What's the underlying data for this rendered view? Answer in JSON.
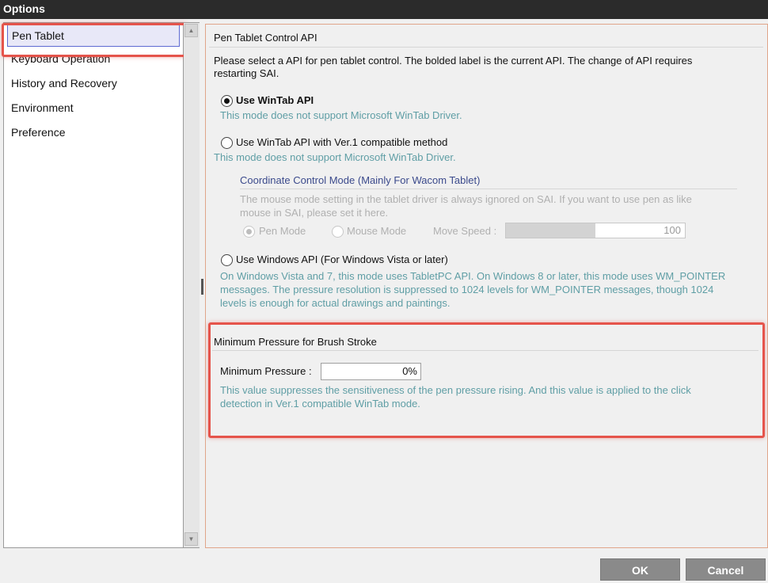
{
  "window": {
    "title": "Options"
  },
  "sidebar": {
    "items": [
      {
        "label": "Pen Tablet"
      },
      {
        "label": "Keyboard Operation"
      },
      {
        "label": "History and Recovery"
      },
      {
        "label": "Environment"
      },
      {
        "label": "Preference"
      }
    ]
  },
  "api_section": {
    "title": "Pen Tablet Control API",
    "intro_line1": "Please select a API for pen tablet control. The bolded label is the current API. The change of API requires",
    "intro_line2": "restarting SAI.",
    "options": [
      {
        "label": "Use WinTab API",
        "desc": "This mode does not support Microsoft WinTab Driver.",
        "selected": true
      },
      {
        "label": "Use WinTab API with Ver.1 compatible method",
        "desc": "This mode does not support Microsoft WinTab Driver.",
        "selected": false
      },
      {
        "label": "Use Windows API (For Windows Vista or later)",
        "desc_line1": "On Windows Vista and 7, this mode uses TabletPC API. On Windows 8 or later, this mode uses WM_POINTER",
        "desc_line2": "messages. The pressure resolution is suppressed to 1024 levels for WM_POINTER messages, though 1024",
        "desc_line3": "levels is enough for actual drawings and paintings.",
        "selected": false
      }
    ],
    "coordinate": {
      "title": "Coordinate Control Mode (Mainly For Wacom Tablet)",
      "desc_line1": "The mouse mode setting in the tablet driver is always ignored on SAI. If you want to use pen as like",
      "desc_line2": "mouse in SAI, please set it here.",
      "pen_mode": "Pen Mode",
      "mouse_mode": "Mouse Mode",
      "move_speed_label": "Move Speed :",
      "move_speed_value": "100",
      "move_speed_fraction": 0.5
    }
  },
  "pressure_section": {
    "title": "Minimum Pressure for Brush Stroke",
    "label": "Minimum Pressure :",
    "value": "0%",
    "desc_line1": "This value suppresses the sensitiveness of the pen pressure rising. And this value is applied to the click",
    "desc_line2": "detection in Ver.1 compatible WinTab mode."
  },
  "buttons": {
    "ok": "OK",
    "cancel": "Cancel"
  },
  "colors": {
    "highlight": "#e5544b",
    "section_title": "#8b3a14",
    "description": "#5f9ea5",
    "subheading": "#3b4a8c"
  }
}
